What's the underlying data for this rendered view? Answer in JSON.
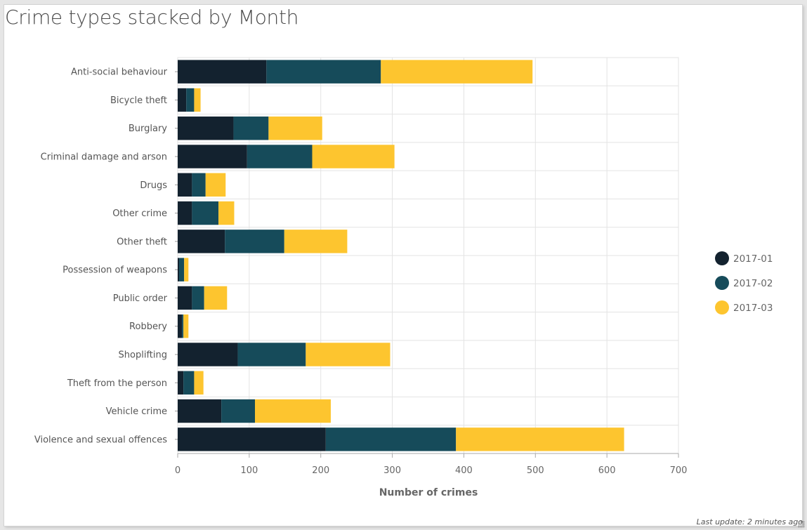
{
  "widget": {
    "title": "Crime types stacked by Month",
    "footer": "Last update: 2 minutes ago",
    "resize_handle_icon": "resize-grip-icon"
  },
  "chart_data": {
    "type": "bar",
    "orientation": "horizontal",
    "stacked": true,
    "title": "Crime types stacked by Month",
    "xlabel": "Number of crimes",
    "ylabel": "",
    "xlim": [
      0,
      700
    ],
    "xticks": [
      0,
      100,
      200,
      300,
      400,
      500,
      600,
      700
    ],
    "grid": true,
    "legend_position": "right",
    "categories": [
      "Anti-social behaviour",
      "Bicycle theft",
      "Burglary",
      "Criminal damage and arson",
      "Drugs",
      "Other crime",
      "Other theft",
      "Possession of weapons",
      "Public order",
      "Robbery",
      "Shoplifting",
      "Theft from the person",
      "Vehicle crime",
      "Violence and sexual offences"
    ],
    "series": [
      {
        "name": "2017-01",
        "color": "#13222f",
        "values": [
          124,
          12,
          78,
          97,
          20,
          20,
          66,
          2,
          20,
          6,
          84,
          8,
          61,
          207
        ]
      },
      {
        "name": "2017-02",
        "color": "#164b5a",
        "values": [
          160,
          11,
          49,
          91,
          19,
          37,
          83,
          7,
          17,
          2,
          95,
          15,
          47,
          182
        ]
      },
      {
        "name": "2017-03",
        "color": "#fdc52f",
        "values": [
          212,
          9,
          75,
          115,
          28,
          22,
          88,
          6,
          32,
          7,
          118,
          13,
          106,
          235
        ]
      }
    ]
  }
}
